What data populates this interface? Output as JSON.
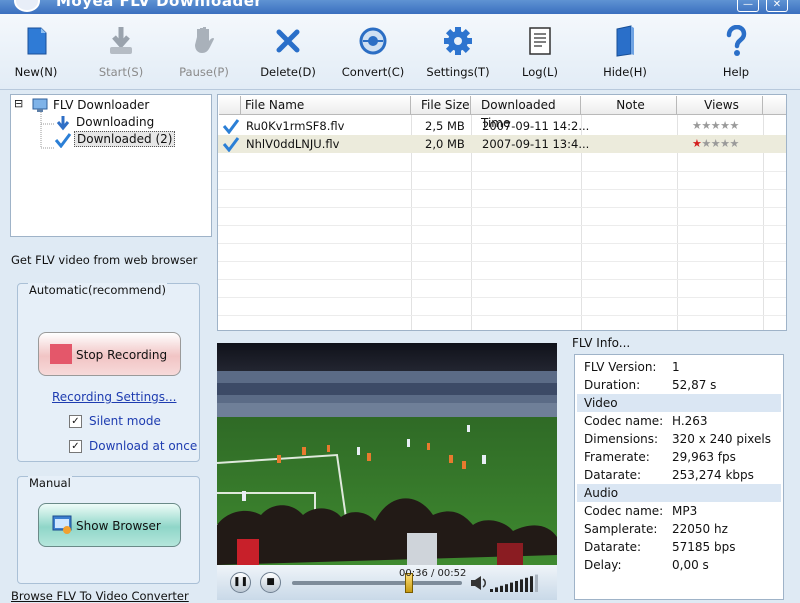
{
  "window": {
    "title": "Moyea FLV Downloader",
    "min_glyph": "—",
    "close_glyph": "✕"
  },
  "toolbar": [
    {
      "label": "New(N)",
      "icon": "document-icon",
      "enabled": true
    },
    {
      "label": "Start(S)",
      "icon": "start-icon",
      "enabled": false
    },
    {
      "label": "Pause(P)",
      "icon": "pause-hand-icon",
      "enabled": false
    },
    {
      "label": "Delete(D)",
      "icon": "delete-x-icon",
      "enabled": true
    },
    {
      "label": "Convert(C)",
      "icon": "convert-disc-icon",
      "enabled": true
    },
    {
      "label": "Settings(T)",
      "icon": "gear-icon",
      "enabled": true
    },
    {
      "label": "Log(L)",
      "icon": "log-icon",
      "enabled": true
    },
    {
      "label": "Hide(H)",
      "icon": "hide-book-icon",
      "enabled": true
    },
    {
      "label": "Help",
      "icon": "help-icon",
      "enabled": true
    }
  ],
  "tree": {
    "root": "FLV Downloader",
    "collapse_glyph": "⊟",
    "children": [
      "Downloading",
      "Downloaded (2)"
    ]
  },
  "left": {
    "heading": "Get FLV video from web browser",
    "automatic_title": "Automatic(recommend)",
    "stop_label": "Stop Recording",
    "settings_link": "Recording Settings...",
    "silent_label": "Silent mode",
    "silent_checked": true,
    "download_label": "Download at once",
    "download_checked": true,
    "check_glyph": "✓",
    "manual_title": "Manual",
    "browser_label": "Show Browser",
    "bottom_link": "Browse FLV To Video Converter"
  },
  "files": {
    "columns": [
      "File Name",
      "File Size",
      "Downloaded Time",
      "Note",
      "Views"
    ],
    "rows": [
      {
        "name": "Ru0Kv1rmSF8.flv",
        "size": "2,5 MB",
        "time": "2007-09-11 14:2...",
        "note": "",
        "stars": "★★★★★",
        "rated": 0
      },
      {
        "name": "NhlV0ddLNJU.flv",
        "size": "2,0 MB",
        "time": "2007-09-11 13:4...",
        "note": "",
        "stars": "★★★★★",
        "rated": 1
      }
    ]
  },
  "player": {
    "time": "00:36 / 00:52",
    "progress": 0.69,
    "volume": 0.9
  },
  "info": {
    "title": "FLV Info...",
    "rows": [
      {
        "k": "FLV Version:",
        "v": "1"
      },
      {
        "k": "Duration:",
        "v": "52,87 s"
      },
      {
        "section": "Video"
      },
      {
        "k": "Codec name:",
        "v": "H.263"
      },
      {
        "k": "Dimensions:",
        "v": "320 x 240 pixels"
      },
      {
        "k": "Framerate:",
        "v": "29,963 fps"
      },
      {
        "k": "Datarate:",
        "v": "253,274 kbps"
      },
      {
        "section": "Audio"
      },
      {
        "k": "Codec name:",
        "v": "MP3"
      },
      {
        "k": "Samplerate:",
        "v": "22050 hz"
      },
      {
        "k": "Datarate:",
        "v": "57185 bps"
      },
      {
        "k": "Delay:",
        "v": "0,00 s"
      }
    ]
  },
  "colors": {
    "accent": "#3a6fbf",
    "rated_star": "#d42020",
    "unrated_star": "#9a9a9a",
    "record_button": "#e4576a"
  }
}
